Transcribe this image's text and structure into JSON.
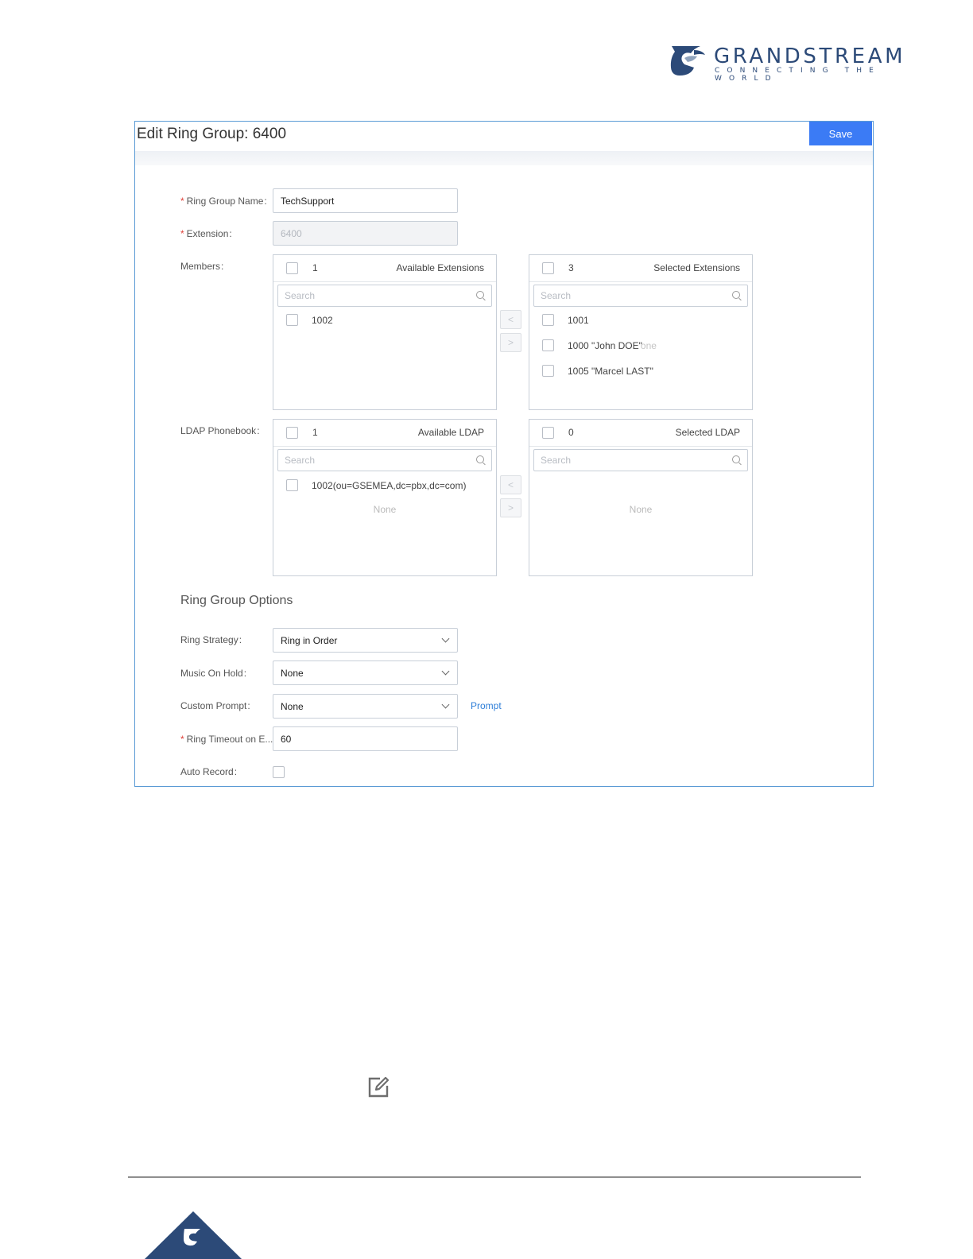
{
  "brand": {
    "name": "GRANDSTREAM",
    "tagline": "CONNECTING THE WORLD",
    "color": "#2c4a78"
  },
  "dialog": {
    "title": "Edit Ring Group: 6400",
    "save_label": "Save"
  },
  "form": {
    "ring_group_name": {
      "label": "Ring Group Name",
      "value": "TechSupport",
      "required": true
    },
    "extension": {
      "label": "Extension",
      "value": "6400",
      "required": true,
      "disabled": true
    },
    "members_label": "Members",
    "ldap_label": "LDAP Phonebook"
  },
  "members": {
    "available": {
      "count": "1",
      "title": "Available Extensions",
      "search_placeholder": "Search",
      "items": [
        "1002"
      ]
    },
    "selected": {
      "count": "3",
      "title": "Selected Extensions",
      "search_placeholder": "Search",
      "items": [
        "1001",
        "1000 \"John DOE\"",
        "1005 \"Marcel LAST\""
      ],
      "overlap_text": "one"
    },
    "move_left": "<",
    "move_right": ">"
  },
  "ldap": {
    "available": {
      "count": "1",
      "title": "Available LDAP",
      "search_placeholder": "Search",
      "items": [
        "1002(ou=GSEMEA,dc=pbx,dc=com)"
      ],
      "empty_text": "None"
    },
    "selected": {
      "count": "0",
      "title": "Selected LDAP",
      "search_placeholder": "Search",
      "empty_text": "None"
    },
    "move_left": "<",
    "move_right": ">"
  },
  "options": {
    "section_title": "Ring Group Options",
    "ring_strategy": {
      "label": "Ring Strategy",
      "value": "Ring in Order"
    },
    "music_on_hold": {
      "label": "Music On Hold",
      "value": "None"
    },
    "custom_prompt": {
      "label": "Custom Prompt",
      "value": "None",
      "link": "Prompt"
    },
    "ring_timeout": {
      "label": "Ring Timeout on E...",
      "value": "60",
      "required": true
    },
    "auto_record": {
      "label": "Auto Record",
      "checked": false
    }
  },
  "icons": {
    "edit": "edit-icon",
    "footer_logo": "grandstream-logo-icon"
  },
  "colors": {
    "accent": "#3b7bf5",
    "required": "#e0413a",
    "link": "#2f7fd8",
    "frame": "#5b9bd5"
  }
}
